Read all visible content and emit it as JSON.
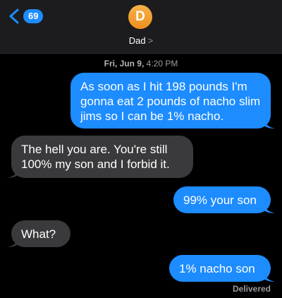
{
  "header": {
    "back_count": "69",
    "avatar_initial": "D",
    "contact_name": "Dad",
    "contact_chevron": ">"
  },
  "timestamp": {
    "day": "Fri, Jun 9,",
    "time": "4:20 PM"
  },
  "messages": [
    {
      "direction": "sent",
      "text": "As soon as I hit 198 pounds I'm gonna eat 2 pounds of nacho slim jims so I can be 1% nacho."
    },
    {
      "direction": "received",
      "text": "The hell you are. You're still 100% my son and I forbid it."
    },
    {
      "direction": "sent",
      "text": "99% your son"
    },
    {
      "direction": "received",
      "text": "What?"
    },
    {
      "direction": "sent",
      "text": "1% nacho son"
    }
  ],
  "status": "Delivered",
  "colors": {
    "sent_bubble": "#1d8cff",
    "received_bubble": "#3a3a3c",
    "background": "#000000",
    "avatar": "#ef8f1e"
  },
  "icons": {
    "back": "chevron-left-icon",
    "contact_details": "chevron-right-icon"
  }
}
